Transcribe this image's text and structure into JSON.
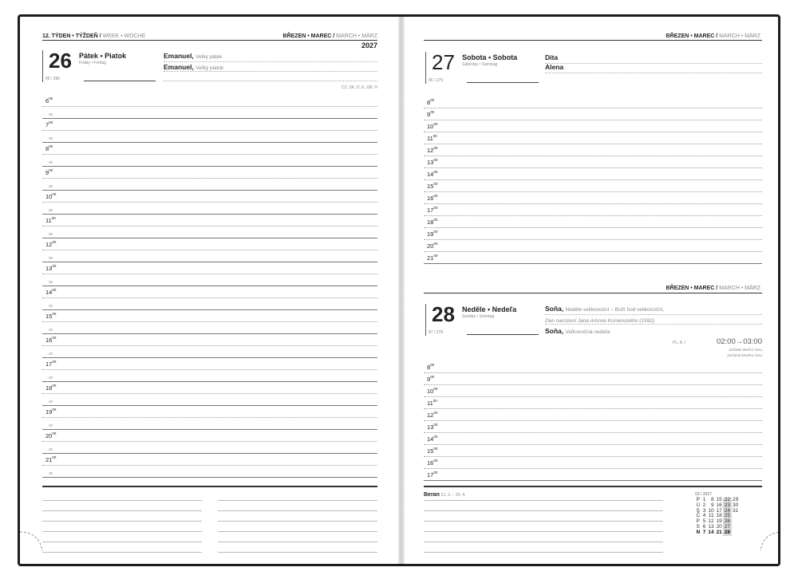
{
  "left": {
    "header": {
      "week": "12. TÝDEN • TÝŽDEŇ /",
      "week_other": "WEEK • WOCHE",
      "month": "BŘEZEN • MAREC /",
      "month_other": "MARCH • MÄRZ"
    },
    "year": "2027",
    "day": {
      "number": "26",
      "name": "Pátek • Piatok",
      "sub": "Friday • Freitag",
      "count": "85 / 280",
      "names": [
        {
          "name": "Emanuel,",
          "detail": "Velký pátek"
        },
        {
          "name": "Emanuel,",
          "detail": "Veľký piatok"
        }
      ],
      "countries": "CZ, SK, D, E, GB, H"
    },
    "hours": [
      {
        "h": "6",
        "m": "00",
        "half": "30"
      },
      {
        "h": "7",
        "m": "00",
        "half": "30"
      },
      {
        "h": "8",
        "m": "00",
        "half": "30"
      },
      {
        "h": "9",
        "m": "00",
        "half": "30"
      },
      {
        "h": "10",
        "m": "00",
        "half": "30"
      },
      {
        "h": "11",
        "m": "00",
        "half": "30"
      },
      {
        "h": "12",
        "m": "00",
        "half": "30"
      },
      {
        "h": "13",
        "m": "00",
        "half": "30"
      },
      {
        "h": "14",
        "m": "00",
        "half": "30"
      },
      {
        "h": "15",
        "m": "00",
        "half": "30"
      },
      {
        "h": "16",
        "m": "00",
        "half": "30"
      },
      {
        "h": "17",
        "m": "00",
        "half": "30"
      },
      {
        "h": "18",
        "m": "00",
        "half": "30"
      },
      {
        "h": "19",
        "m": "00",
        "half": "30"
      },
      {
        "h": "20",
        "m": "00",
        "half": "30"
      },
      {
        "h": "21",
        "m": "00",
        "half": "30"
      }
    ]
  },
  "right": {
    "header": {
      "month": "BŘEZEN • MAREC /",
      "month_other": "MARCH • MÄRZ"
    },
    "sat": {
      "number": "27",
      "name": "Sobota • Sobota",
      "sub": "Saturday • Samstag",
      "count": "86 / 279",
      "names": [
        {
          "name": "Dita"
        },
        {
          "name": "Alena"
        }
      ],
      "hours": [
        {
          "h": "8",
          "m": "00"
        },
        {
          "h": "9",
          "m": "00"
        },
        {
          "h": "10",
          "m": "00"
        },
        {
          "h": "11",
          "m": "00"
        },
        {
          "h": "12",
          "m": "00"
        },
        {
          "h": "13",
          "m": "00"
        },
        {
          "h": "14",
          "m": "00"
        },
        {
          "h": "15",
          "m": "00"
        },
        {
          "h": "16",
          "m": "00"
        },
        {
          "h": "17",
          "m": "00"
        },
        {
          "h": "18",
          "m": "00"
        },
        {
          "h": "19",
          "m": "00"
        },
        {
          "h": "20",
          "m": "00"
        },
        {
          "h": "21",
          "m": "00"
        }
      ]
    },
    "sun": {
      "header": {
        "month": "BŘEZEN • MAREC /",
        "month_other": "MARCH • MÄRZ"
      },
      "number": "28",
      "name": "Neděle • Nedeľa",
      "sub": "Sunday • Sonntag",
      "count": "87 / 278",
      "names": [
        {
          "name": "Soňa,",
          "detail": "Neděle velikonoční – Boží hod velikonoční,"
        },
        {
          "name": "",
          "detail": "Den narození Jana Amose Komenského (1592)"
        },
        {
          "name": "Soňa,",
          "detail": "Veľkonočná nedeľa"
        }
      ],
      "dst": {
        "countries": "PL, A, I",
        "time": "02:00→03:00",
        "line1": "Začátek letního času",
        "line2": "Začiatok letného času"
      },
      "hours": [
        {
          "h": "8",
          "m": "00"
        },
        {
          "h": "9",
          "m": "00"
        },
        {
          "h": "10",
          "m": "00"
        },
        {
          "h": "11",
          "m": "00"
        },
        {
          "h": "12",
          "m": "00"
        },
        {
          "h": "13",
          "m": "00"
        },
        {
          "h": "14",
          "m": "00"
        },
        {
          "h": "15",
          "m": "00"
        },
        {
          "h": "16",
          "m": "00"
        },
        {
          "h": "17",
          "m": "00"
        }
      ]
    },
    "zodiac": {
      "name": "Beran",
      "range": "21. 3. – 20. 4."
    },
    "calendar": {
      "title": "03 / 2027",
      "rows": [
        {
          "label": "P",
          "days": [
            "1",
            "8",
            "15",
            "22",
            "29"
          ]
        },
        {
          "label": "Ú",
          "days": [
            "2",
            "9",
            "16",
            "23",
            "30"
          ]
        },
        {
          "label": "S",
          "days": [
            "3",
            "10",
            "17",
            "24",
            "31"
          ]
        },
        {
          "label": "Č",
          "days": [
            "4",
            "11",
            "18",
            "25",
            ""
          ]
        },
        {
          "label": "P",
          "days": [
            "5",
            "12",
            "19",
            "26",
            ""
          ]
        },
        {
          "label": "S",
          "days": [
            "6",
            "13",
            "20",
            "27",
            ""
          ]
        },
        {
          "label": "N",
          "days": [
            "7",
            "14",
            "21",
            "28",
            ""
          ]
        }
      ],
      "highlight_column": 3
    }
  }
}
